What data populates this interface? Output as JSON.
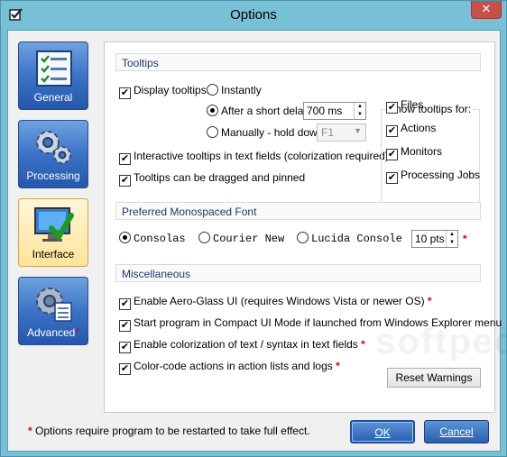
{
  "window": {
    "title": "Options",
    "close_glyph": "✕"
  },
  "nav": [
    {
      "label": "General",
      "icon": "checklist-icon",
      "active": false,
      "required": ""
    },
    {
      "label": "Processing",
      "icon": "gears-icon",
      "active": false,
      "required": ""
    },
    {
      "label": "Interface",
      "icon": "monitor-check-icon",
      "active": true,
      "required": ""
    },
    {
      "label": "Advanced",
      "icon": "advanced-gear-icon",
      "active": false,
      "required": "*"
    }
  ],
  "tooltips": {
    "heading": "Tooltips",
    "display_label": "Display tooltips:",
    "display_checked": true,
    "mode_instantly": "Instantly",
    "mode_short_delay": "After a short delay:",
    "mode_manual": "Manually - hold down:",
    "delay_value": "700 ms",
    "hotkey_value": "F1",
    "interactive_label": "Interactive tooltips in text fields (colorization required)",
    "interactive_checked": true,
    "drag_label": "Tooltips can be dragged and pinned",
    "drag_checked": true,
    "show_for_title": "Show tooltips for:",
    "show_for": [
      {
        "label": "Files",
        "checked": true
      },
      {
        "label": "Actions",
        "checked": true
      },
      {
        "label": "Monitors",
        "checked": true
      },
      {
        "label": "Processing Jobs",
        "checked": true
      }
    ]
  },
  "font": {
    "heading": "Preferred Monospaced Font",
    "options": [
      "Consolas",
      "Courier New",
      "Lucida Console"
    ],
    "selected": "Consolas",
    "size_value": "10 pts"
  },
  "misc": {
    "heading": "Miscellaneous",
    "items": [
      {
        "label": "Enable Aero-Glass UI (requires Windows Vista or newer OS)",
        "checked": true,
        "restart": true
      },
      {
        "label": "Start program in Compact UI Mode if launched from Windows Explorer menu",
        "checked": true,
        "restart": false
      },
      {
        "label": "Enable colorization of text / syntax in text fields",
        "checked": true,
        "restart": true
      },
      {
        "label": "Color-code actions in action lists and logs",
        "checked": true,
        "restart": true
      }
    ],
    "reset_label": "Reset Warnings"
  },
  "footer": {
    "asterisk": "*",
    "note": "Options require program to be restarted to take full effect.",
    "ok_label": "OK",
    "cancel_label": "Cancel"
  },
  "colors": {
    "frame": "#77c0d6",
    "nav_blue": "#3c73c6",
    "nav_active": "#ffe49a",
    "required_red": "#e00000"
  },
  "check_glyph": "✔"
}
